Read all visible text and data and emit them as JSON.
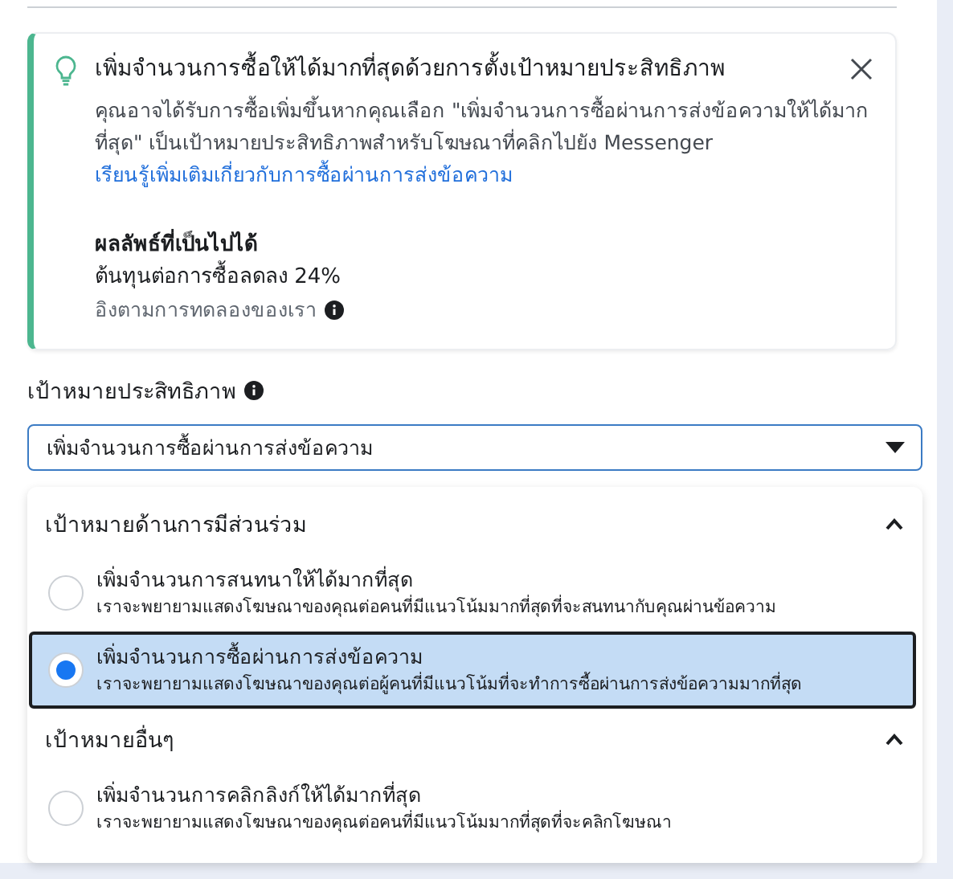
{
  "tip": {
    "title": "เพิ่มจำนวนการซื้อให้ได้มากที่สุดด้วยการตั้งเป้าหมายประสิทธิภาพ",
    "body": "คุณอาจได้รับการซื้อเพิ่มขึ้นหากคุณเลือก \"เพิ่มจำนวนการซื้อผ่านการส่งข้อความให้ได้มากที่สุด\" เป็นเป้าหมายประสิทธิภาพสำหรับโฆษณาที่คลิกไปยัง Messenger",
    "link": "เรียนรู้เพิ่มเติมเกี่ยวกับการซื้อผ่านการส่งข้อความ",
    "result_heading": "ผลลัพธ์ที่เป็นไปได้",
    "result_value": "ต้นทุนต่อการซื้อลดลง 24%",
    "result_note": "อิงตามการทดลองของเรา"
  },
  "goal": {
    "label": "เป้าหมายประสิทธิภาพ",
    "value": "เพิ่มจำนวนการซื้อผ่านการส่งข้อความ"
  },
  "groups": [
    {
      "title": "เป้าหมายด้านการมีส่วนร่วม",
      "expanded": true,
      "options": [
        {
          "title": "เพิ่มจำนวนการสนทนาให้ได้มากที่สุด",
          "description": "เราจะพยายามแสดงโฆษณาของคุณต่อคนที่มีแนวโน้มมากที่สุดที่จะสนทนากับคุณผ่านข้อความ",
          "selected": false
        },
        {
          "title": "เพิ่มจำนวนการซื้อผ่านการส่งข้อความ",
          "description": "เราจะพยายามแสดงโฆษณาของคุณต่อผู้คนที่มีแนวโน้มที่จะทำการซื้อผ่านการส่งข้อความมากที่สุด",
          "selected": true
        }
      ]
    },
    {
      "title": "เป้าหมายอื่นๆ",
      "expanded": true,
      "options": [
        {
          "title": "เพิ่มจำนวนการคลิกลิงก์ให้ได้มากที่สุด",
          "description": "เราจะพยายามแสดงโฆษณาของคุณต่อคนที่มีแนวโน้มมากที่สุดที่จะคลิกโฆษณา",
          "selected": false
        }
      ]
    }
  ]
}
